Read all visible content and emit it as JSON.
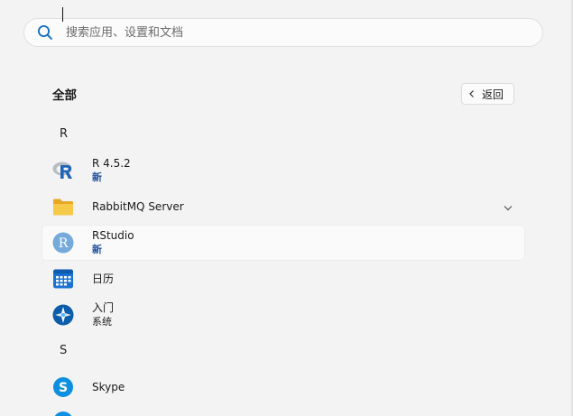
{
  "search": {
    "placeholder": "搜索应用、设置和文档",
    "value": ""
  },
  "section": {
    "title": "全部"
  },
  "back_button": {
    "label": "返回"
  },
  "groups": [
    {
      "letter": "R"
    },
    {
      "letter": "S"
    }
  ],
  "apps": [
    {
      "name": "R 4.5.2",
      "sub": "新",
      "icon": "r-logo-icon"
    },
    {
      "name": "RabbitMQ Server",
      "sub": "",
      "icon": "folder-icon",
      "expandable": true
    },
    {
      "name": "RStudio",
      "sub": "新",
      "icon": "rstudio-icon"
    },
    {
      "name": "日历",
      "sub": "",
      "icon": "calendar-icon"
    },
    {
      "name": "入门",
      "sub": "系统",
      "icon": "get-started-icon"
    },
    {
      "name": "Skype",
      "sub": "",
      "icon": "skype-icon"
    }
  ],
  "colors": {
    "accent": "#0f6cbd",
    "new_badge": "#1f4e9c",
    "background": "#f3f3f3"
  }
}
